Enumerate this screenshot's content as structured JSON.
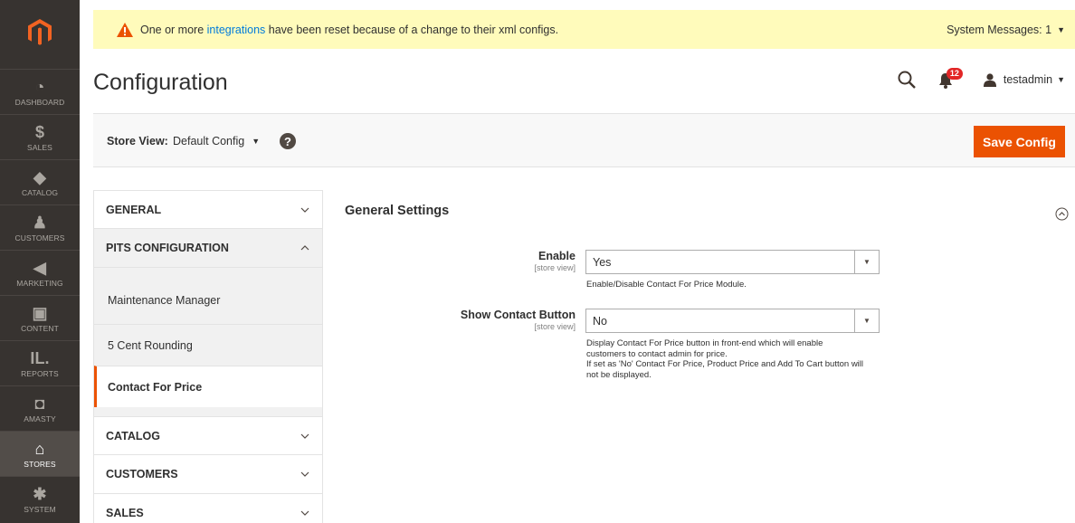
{
  "menu": {
    "items": [
      {
        "label": "DASHBOARD",
        "icon": "dashboard-icon",
        "glyph": "◔"
      },
      {
        "label": "SALES",
        "icon": "dollar-icon",
        "glyph": "$"
      },
      {
        "label": "CATALOG",
        "icon": "box-icon",
        "glyph": "◆"
      },
      {
        "label": "CUSTOMERS",
        "icon": "person-icon",
        "glyph": "♟"
      },
      {
        "label": "MARKETING",
        "icon": "megaphone-icon",
        "glyph": "◀"
      },
      {
        "label": "CONTENT",
        "icon": "layout-icon",
        "glyph": "▣"
      },
      {
        "label": "REPORTS",
        "icon": "bar-chart-icon",
        "glyph": "ıl."
      },
      {
        "label": "AMASTY",
        "icon": "amasty-icon",
        "glyph": "◘"
      },
      {
        "label": "STORES",
        "icon": "store-icon",
        "glyph": "⌂"
      },
      {
        "label": "SYSTEM",
        "icon": "gear-icon",
        "glyph": "✱"
      }
    ]
  },
  "system_message": {
    "prefix": "One or more ",
    "link": "integrations",
    "suffix": " have been reset because of a change to their xml configs.",
    "counter": "System Messages: 1"
  },
  "header": {
    "title": "Configuration",
    "notifications_count": "12",
    "username": "testadmin"
  },
  "store_bar": {
    "label": "Store View:",
    "selected": "Default Config",
    "save_label": "Save Config"
  },
  "tabs": {
    "general": "GENERAL",
    "pits": "PITS CONFIGURATION",
    "pits_items": [
      "Maintenance Manager",
      "5 Cent Rounding",
      "Contact For Price"
    ],
    "catalog": "CATALOG",
    "customers": "CUSTOMERS",
    "sales": "SALES"
  },
  "section": {
    "title": "General Settings",
    "fields": [
      {
        "label": "Enable",
        "scope": "[store view]",
        "value": "Yes",
        "note": [
          "Enable/Disable Contact For Price Module."
        ]
      },
      {
        "label": "Show Contact Button",
        "scope": "[store view]",
        "value": "No",
        "note": [
          "Display Contact For Price button in front-end which will enable",
          "customers to contact admin for price.",
          "If set as 'No' Contact For Price, Product Price and Add To Cart button will",
          "not be displayed."
        ]
      }
    ]
  },
  "colors": {
    "accent": "#eb5202",
    "menu_bg": "#373330",
    "message_bg": "#fffbbb",
    "link": "#007bdb"
  }
}
